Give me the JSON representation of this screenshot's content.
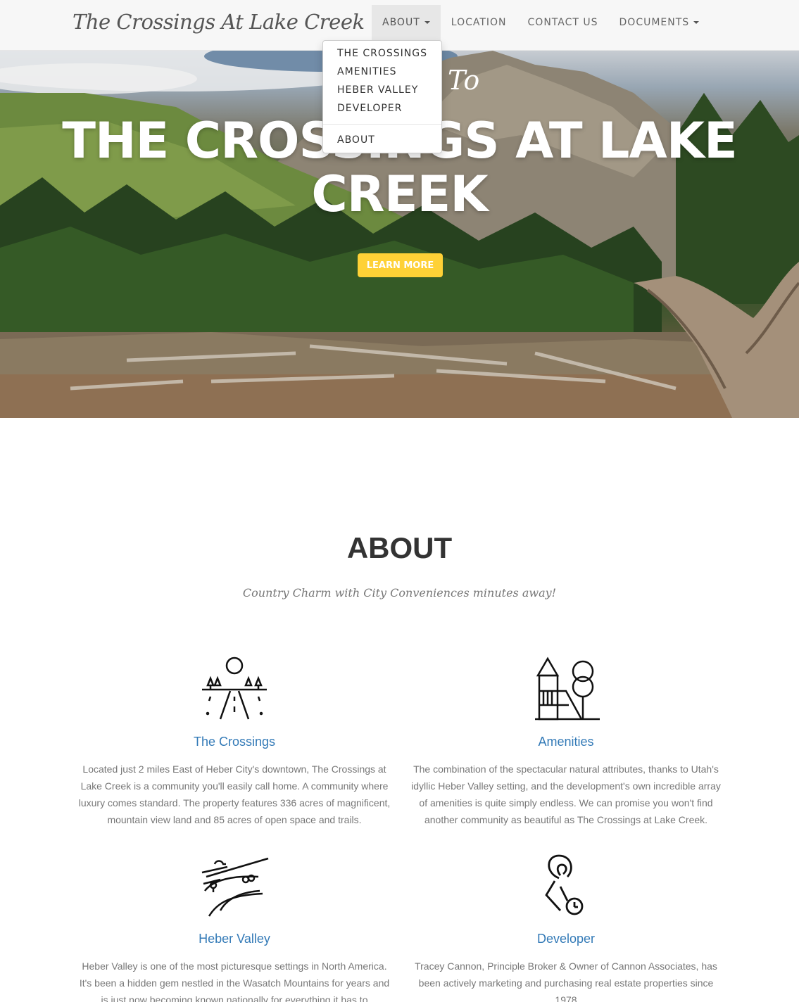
{
  "navbar": {
    "brand": "The Crossings At Lake Creek",
    "items": [
      {
        "label": "ABOUT",
        "has_caret": true,
        "open": true
      },
      {
        "label": "LOCATION"
      },
      {
        "label": "CONTACT US"
      },
      {
        "label": "DOCUMENTS",
        "has_caret": true
      }
    ],
    "dropdown": [
      "THE CROSSINGS",
      "AMENITIES",
      "HEBER VALLEY",
      "DEVELOPER",
      "ABOUT"
    ]
  },
  "hero": {
    "pretitle": "To",
    "title": "THE CROSSINGS AT LAKE CREEK",
    "button": "LEARN MORE",
    "button_color": "#fed136"
  },
  "about": {
    "heading": "ABOUT",
    "subheading": "Country Charm with City Conveniences minutes away!",
    "cards": [
      {
        "title": "The Crossings",
        "icon": "road-trees-sun-icon",
        "text": "Located just 2 miles East of Heber City's downtown, The Crossings at Lake Creek is a community you'll easily call home. A community where luxury comes standard. The property features 336 acres of magnificent, mountain view land and 85 acres of open space and trails."
      },
      {
        "title": "Amenities",
        "icon": "playground-tree-icon",
        "text": "The combination of the spectacular natural attributes, thanks to Utah's idyllic Heber Valley setting, and the development's own incredible array of amenities is quite simply endless. We can promise you won't find another community as beautiful as The Crossings at Lake Creek."
      },
      {
        "title": "Heber Valley",
        "icon": "valley-landscape-icon",
        "text": "Heber Valley is one of the most picturesque settings in North America. It's been a hidden gem nestled in the Wasatch Mountains for years and is just now becoming known nationally for everything it has to"
      },
      {
        "title": "Developer",
        "icon": "route-pin-clock-icon",
        "text": "Tracey Cannon, Principle Broker & Owner of Cannon Associates, has been actively marketing and purchasing real estate properties since 1978"
      }
    ]
  },
  "colors": {
    "link": "#337ab7",
    "accent": "#fed136",
    "navbar_bg": "#f7f7f7"
  }
}
